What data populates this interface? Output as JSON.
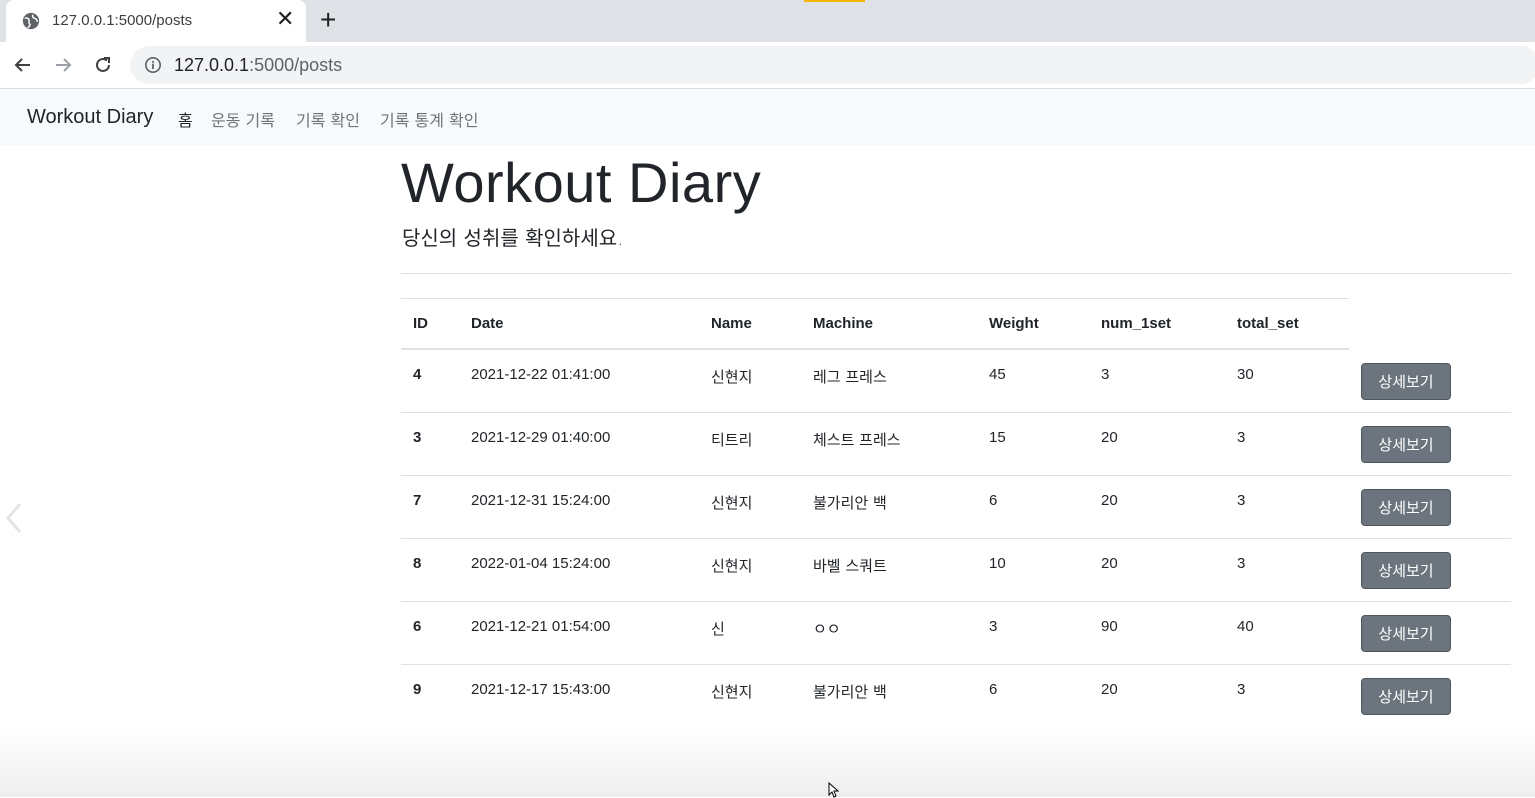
{
  "browser": {
    "tab_title": "127.0.0.1:5000/posts",
    "url_host": "127.0.0.1",
    "url_path": ":5000/posts"
  },
  "nav": {
    "brand": "Workout Diary",
    "links": [
      "홈",
      "운동 기록",
      "기록 확인",
      "기록 통계 확인"
    ]
  },
  "header": {
    "title": "Workout Diary",
    "subtitle": "당신의 성취를 확인하세요."
  },
  "table": {
    "columns": [
      "ID",
      "Date",
      "Name",
      "Machine",
      "Weight",
      "num_1set",
      "total_set"
    ],
    "button_label": "상세보기",
    "rows": [
      {
        "id": "4",
        "date": "2021-12-22 01:41:00",
        "name": "신현지",
        "machine": "레그 프레스",
        "weight": "45",
        "num_1set": "3",
        "total_set": "30"
      },
      {
        "id": "3",
        "date": "2021-12-29 01:40:00",
        "name": "티트리",
        "machine": "체스트 프레스",
        "weight": "15",
        "num_1set": "20",
        "total_set": "3"
      },
      {
        "id": "7",
        "date": "2021-12-31 15:24:00",
        "name": "신현지",
        "machine": "불가리안 백",
        "weight": "6",
        "num_1set": "20",
        "total_set": "3"
      },
      {
        "id": "8",
        "date": "2022-01-04 15:24:00",
        "name": "신현지",
        "machine": "바벨 스쿼트",
        "weight": "10",
        "num_1set": "20",
        "total_set": "3"
      },
      {
        "id": "6",
        "date": "2021-12-21 01:54:00",
        "name": "신",
        "machine": "ㅇㅇ",
        "weight": "3",
        "num_1set": "90",
        "total_set": "40"
      },
      {
        "id": "9",
        "date": "2021-12-17 15:43:00",
        "name": "신현지",
        "machine": "불가리안 백",
        "weight": "6",
        "num_1set": "20",
        "total_set": "3"
      }
    ]
  }
}
